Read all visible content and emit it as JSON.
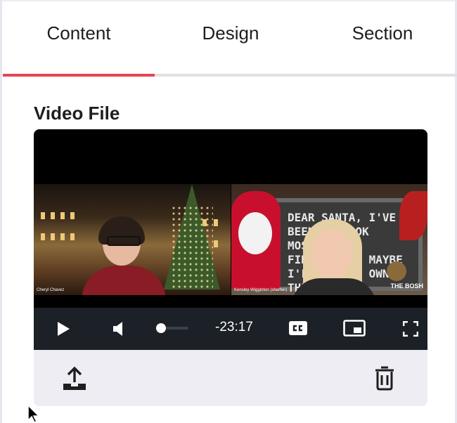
{
  "tabs": [
    {
      "label": "Content",
      "active": true
    },
    {
      "label": "Design",
      "active": false
    },
    {
      "label": "Section",
      "active": false
    }
  ],
  "section": {
    "label": "Video File"
  },
  "player": {
    "time_remaining": "-23:17",
    "volume_level": 0.0,
    "video": {
      "left_caption": "Cheryl Chavez",
      "right_caption": "Kensley Wigginton (she/her)",
      "board_text": "DEAR SANTA, I'VE BEEN GOOD OK MOSTLY. OK FINALLY, OK MAYBE I'LL BUY MY OWN THING!",
      "watermark": "THE BOSH"
    },
    "icons": {
      "play": "play-icon",
      "mute": "volume-muted-icon",
      "cc": "closed-captions-icon",
      "pip": "picture-in-picture-icon",
      "fullscreen": "fullscreen-icon"
    }
  },
  "footer": {
    "upload_icon": "upload-icon",
    "delete_icon": "trash-icon"
  },
  "colors": {
    "accent": "#e8444f",
    "controls_bg": "#1c2128",
    "footer_bg": "#ededf3"
  }
}
